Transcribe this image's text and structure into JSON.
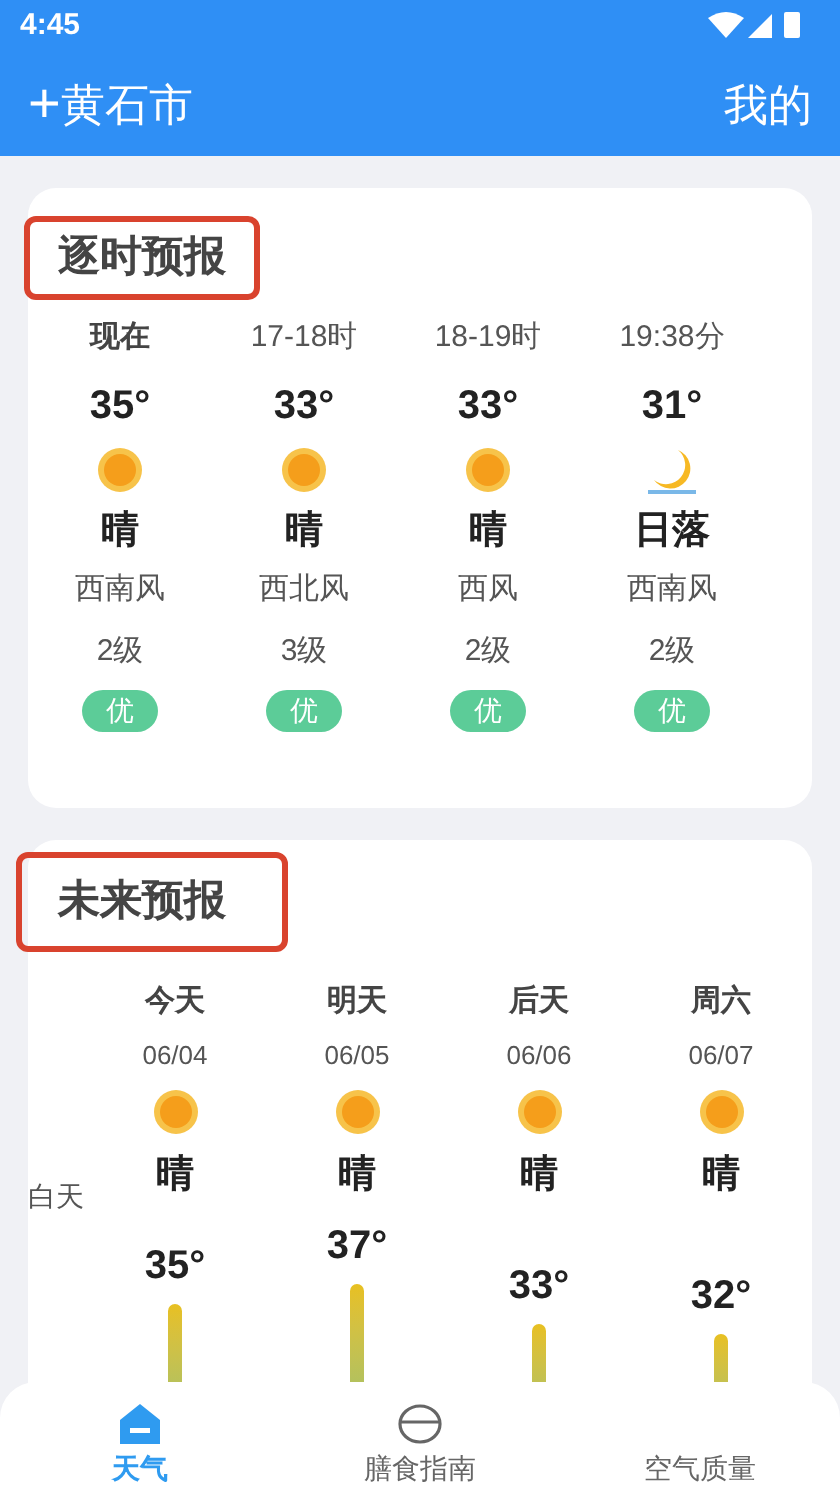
{
  "status_bar": {
    "time": "4:45"
  },
  "header": {
    "add_icon": "+",
    "city": "黄石市",
    "mine": "我的"
  },
  "hourly": {
    "title": "逐时预报",
    "items": [
      {
        "time": "现在",
        "temp": "35°",
        "kind": "sun",
        "condition": "晴",
        "wind": "西南风",
        "level_text": "2级",
        "aqi": "优",
        "bold_time": true
      },
      {
        "time": "17-18时",
        "temp": "33°",
        "kind": "sun",
        "condition": "晴",
        "wind": "西北风",
        "level_text": "3级",
        "aqi": "优",
        "bold_time": false
      },
      {
        "time": "18-19时",
        "temp": "33°",
        "kind": "sun",
        "condition": "晴",
        "wind": "西风",
        "level_text": "2级",
        "aqi": "优",
        "bold_time": false
      },
      {
        "time": "19:38分",
        "temp": "31°",
        "kind": "sunset",
        "condition": "日落",
        "wind": "西南风",
        "level_text": "2级",
        "aqi": "优",
        "bold_time": false
      }
    ]
  },
  "forecast": {
    "title": "未来预报",
    "row_label": "白天",
    "days": [
      {
        "day": "今天",
        "date": "06/04",
        "kind": "sun",
        "condition": "晴",
        "temp": "35°"
      },
      {
        "day": "明天",
        "date": "06/05",
        "kind": "sun",
        "condition": "晴",
        "temp": "37°"
      },
      {
        "day": "后天",
        "date": "06/06",
        "kind": "sun",
        "condition": "晴",
        "temp": "33°"
      },
      {
        "day": "周六",
        "date": "06/07",
        "kind": "sun",
        "condition": "晴",
        "temp": "32°"
      }
    ]
  },
  "bottom_nav": [
    {
      "label": "天气",
      "kind": "home",
      "selected": true
    },
    {
      "label": "膳食指南",
      "kind": "bowl",
      "selected": false
    },
    {
      "label": "空气质量",
      "kind": "plain",
      "selected": false
    }
  ]
}
